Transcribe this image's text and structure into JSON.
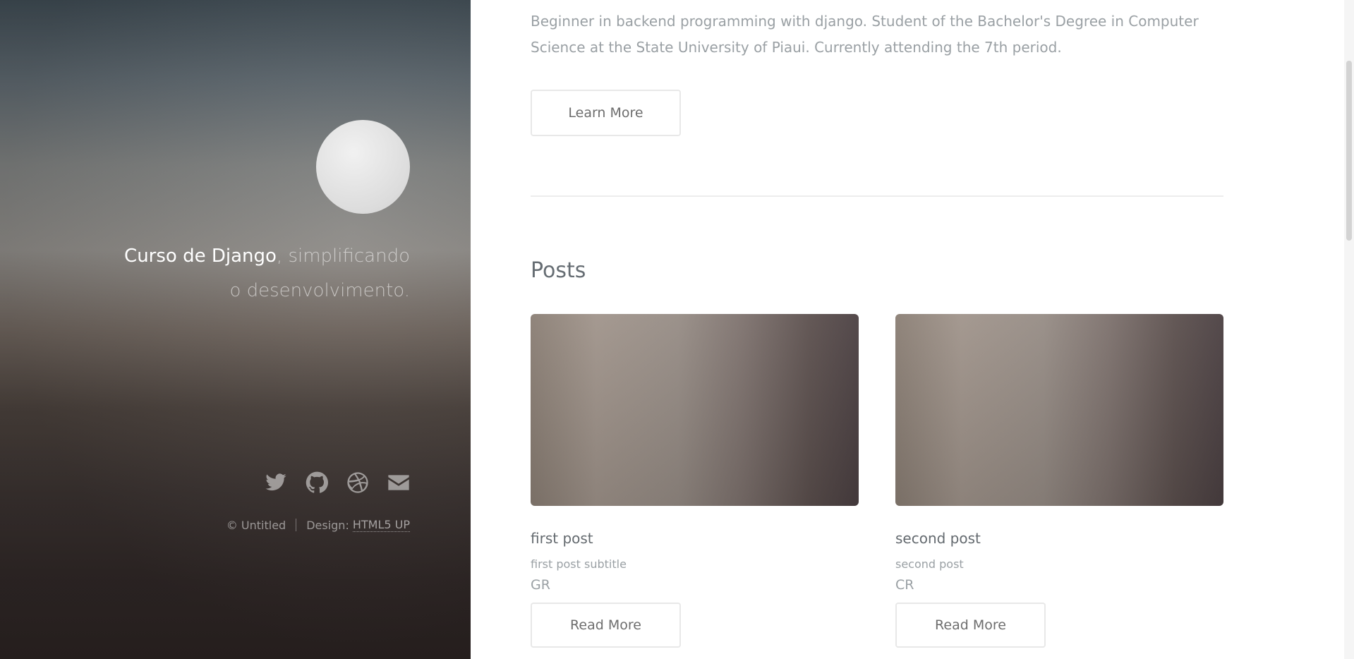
{
  "sidebar": {
    "tagline_strong": "Curso de Django",
    "tagline_rest": ", simplificando o desenvolvimento.",
    "icons": [
      "twitter-icon",
      "github-icon",
      "dribbble-icon",
      "envelope-icon"
    ],
    "copyright": "© Untitled",
    "design_label": "Design:",
    "design_link": "HTML5 UP"
  },
  "main": {
    "intro_text": "Beginner in backend programming with django. Student of the Bachelor's Degree in Computer Science at the State University of Piaui. Currently attending the 7th period.",
    "learn_more_label": "Learn More",
    "posts_heading": "Posts",
    "posts": [
      {
        "title": "first post",
        "subtitle": "first post subtitle",
        "tag": "GR",
        "button": "Read More"
      },
      {
        "title": "second post",
        "subtitle": "second post",
        "tag": "CR",
        "button": "Read More"
      }
    ]
  }
}
